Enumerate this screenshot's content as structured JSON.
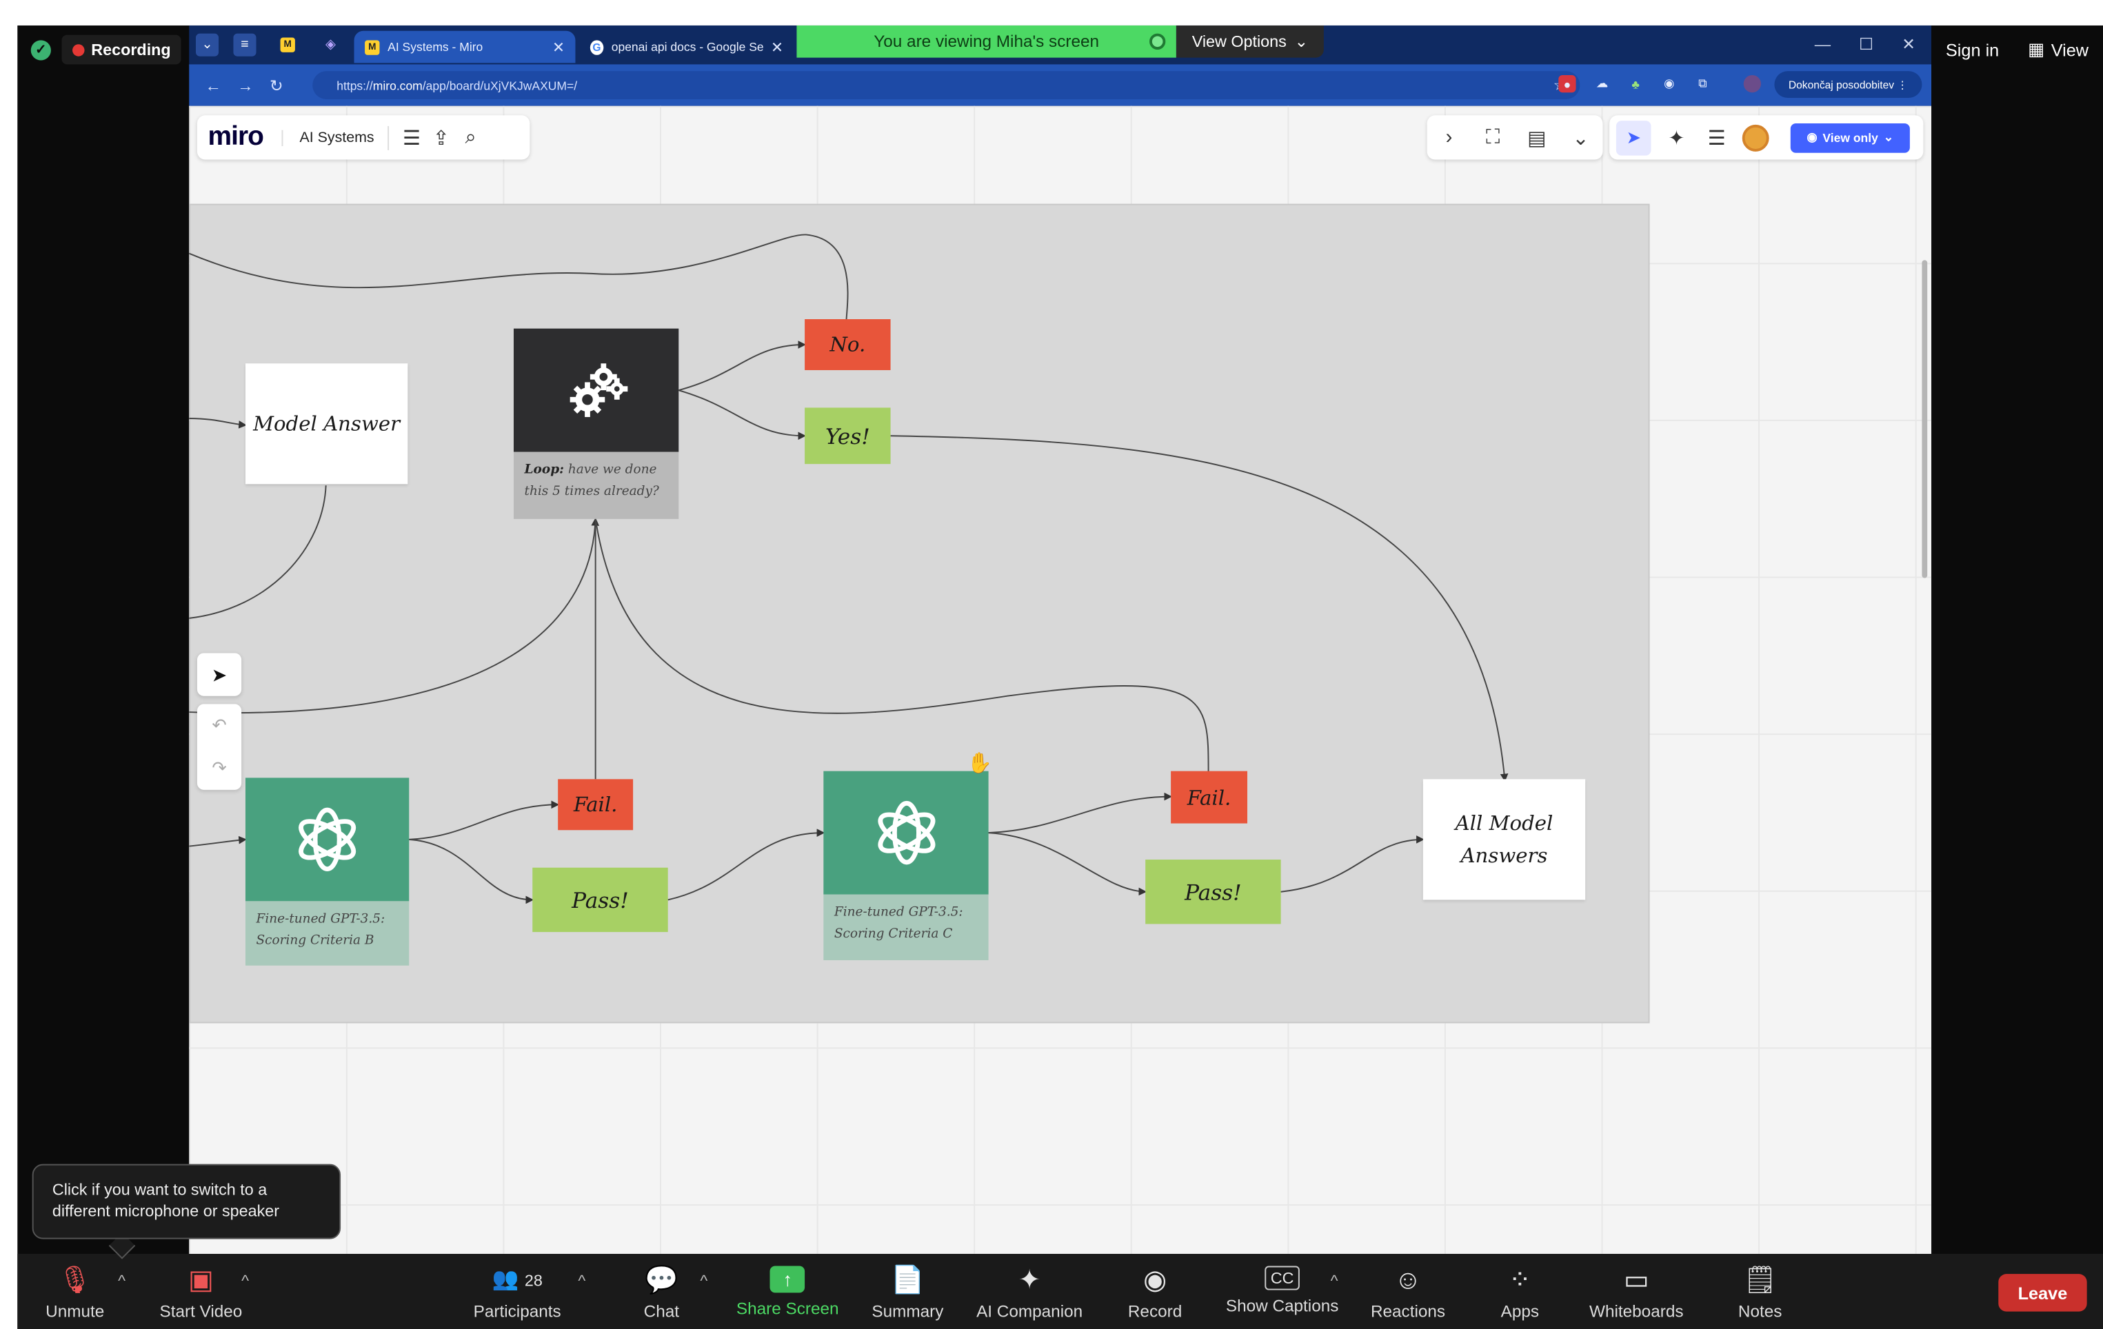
{
  "zoom": {
    "recording_label": "Recording",
    "banner": "You are viewing Miha's screen",
    "view_options": "View Options",
    "sign_in": "Sign in",
    "view": "View",
    "tooltip": "Click if you want to switch to a different microphone or speaker",
    "toolbar": {
      "unmute": "Unmute",
      "start_video": "Start Video",
      "participants": "Participants",
      "participant_count": "28",
      "chat": "Chat",
      "share_screen": "Share Screen",
      "summary": "Summary",
      "ai_companion": "AI Companion",
      "record": "Record",
      "show_captions": "Show Captions",
      "reactions": "Reactions",
      "apps": "Apps",
      "whiteboards": "Whiteboards",
      "notes": "Notes",
      "leave": "Leave"
    }
  },
  "browser": {
    "tabs": [
      {
        "title": "AI Systems - Miro"
      },
      {
        "title": "openai api docs - Google Searc"
      }
    ],
    "url_prefix": "https://",
    "url_site": "miro.com",
    "url_path": "/app/board/uXjVKJwAXUM=/",
    "update_button": "Dokončaj posodobitev"
  },
  "miro": {
    "logo": "miro",
    "board_name": "AI Systems",
    "view_only": "View only",
    "nodes": {
      "model_answer": "Model Answer",
      "no": "No.",
      "yes": "Yes!",
      "fail_1": "Fail.",
      "pass_1": "Pass!",
      "fail_2": "Fail.",
      "pass_2": "Pass!",
      "all_answers": "All Model Answers"
    },
    "loop_caption_bold": "Loop:",
    "loop_caption": "have we done this 5 times already?",
    "gpt_caption_b_1": "Fine-tuned GPT-3.5:",
    "gpt_caption_b_2": "Scoring Criteria B",
    "gpt_caption_c_1": "Fine-tuned GPT-3.5:",
    "gpt_caption_c_2": "Scoring Criteria C"
  },
  "colors": {
    "fail_red": "#e8553a",
    "pass_green": "#a7d064",
    "gpt_green": "#49a17f",
    "miro_blue": "#4262ff",
    "zoom_green": "#4cd964",
    "leave_red": "#c9302c"
  }
}
